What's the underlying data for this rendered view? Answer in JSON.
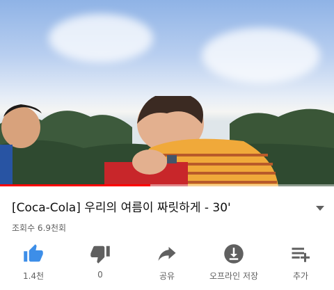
{
  "video": {
    "title": "[Coca-Cola] 우리의 여름이 짜릿하게 - 30'",
    "views": "조회수 6.9천회",
    "progress_fraction": 0.45
  },
  "actions": [
    {
      "name": "like-button",
      "icon": "thumbs-up-icon",
      "label": "1.4천"
    },
    {
      "name": "dislike-button",
      "icon": "thumbs-down-icon",
      "label": "0"
    },
    {
      "name": "share-button",
      "icon": "share-icon",
      "label": "공유"
    },
    {
      "name": "download-button",
      "icon": "download-icon",
      "label": "오프라인 저장"
    },
    {
      "name": "add-to-playlist-button",
      "icon": "playlist-add-icon",
      "label": "추가"
    }
  ],
  "colors": {
    "like_active": "#3d8ee8",
    "icon_gray": "#606060",
    "progress": "#ff0000"
  }
}
